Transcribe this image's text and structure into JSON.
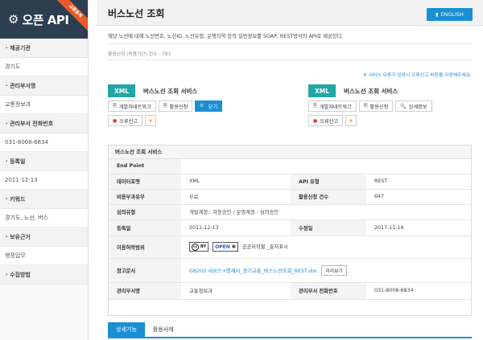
{
  "sidebar": {
    "logo_text": "오픈 API",
    "ribbon": "교통통계",
    "items": [
      {
        "label": "· 제공기관",
        "value": "경기도"
      },
      {
        "label": "· 관리부서명",
        "value": "교통정보과"
      },
      {
        "label": "· 관리부서 전화번호",
        "value": "031-8008-6834"
      },
      {
        "label": "· 등록일",
        "value": "2011-12-13"
      },
      {
        "label": "· 키워드",
        "value": "경기도, 노선, 버스"
      },
      {
        "label": "· 보유근거",
        "value": "행정업무"
      },
      {
        "label": "· 수집방법",
        "value": ""
      }
    ]
  },
  "header": {
    "title": "버스노선 조회",
    "english_button": "ENGLISH"
  },
  "description": "해당 노선에 대해 노선번호, 노선ID, 노선유형, 운행지역 등의 일반정보를 SOAP, REST방식의 API로 제공한다.",
  "apply_count": "활용신청 (허용기간) 건수 : 783",
  "notice": "※ 서비스 오류가 있음시 오류신고 버튼을 이용해주세요.",
  "cards": [
    {
      "badge": "XML",
      "title": "버스노선 조회 서비스",
      "buttons": [
        "개발자네트워크",
        "활용신청",
        "닫기"
      ],
      "report": "오류신고"
    },
    {
      "badge": "XML",
      "title": "버스노선 조회 서비스",
      "buttons": [
        "개발자네트워크",
        "활용신청",
        "상세정보"
      ],
      "report": "오류신고"
    }
  ],
  "detail": {
    "caption": "버스노선 조회 서비스",
    "end_point_label": "End Point",
    "end_point_value": "",
    "data_format_label": "데이터포맷",
    "data_format_value": "XML",
    "api_type_label": "API 유형",
    "api_type_value": "REST",
    "cost_label": "비용부과유무",
    "cost_value": "무료",
    "use_count_label": "활용신청 건수",
    "use_count_value": "647",
    "approval_label": "심의유형",
    "approval_value": "개발계정 : 자동승인 / 운영계정 : 심의승인",
    "reg_date_label": "등록일",
    "reg_date_value": "2011-12-13",
    "mod_date_label": "수정일",
    "mod_date_value": "2017-11-16",
    "license_label": "이용허락범위",
    "license_cc_text": "BY",
    "license_open_text": "OPEN",
    "license_desc": "공공저작물 _출처표시",
    "ref_doc_label": "참고문서",
    "ref_doc_link": "GB202 서비스+명세서_경기교통_버스노선조회_REST.doc",
    "preview_button": "미리보기",
    "dept_label": "관리부서명",
    "dept_value": "교통정보과",
    "dept_phone_label": "관리부서 전화번호",
    "dept_phone_value": "031-8008-6834"
  },
  "tabs": [
    "상세기능",
    "활용사례"
  ],
  "colors": {
    "accent": "#1a8fd6",
    "xml_badge": "#22a6a6",
    "ribbon": "#e85a2a",
    "logo_bg": "#2c3e50"
  }
}
